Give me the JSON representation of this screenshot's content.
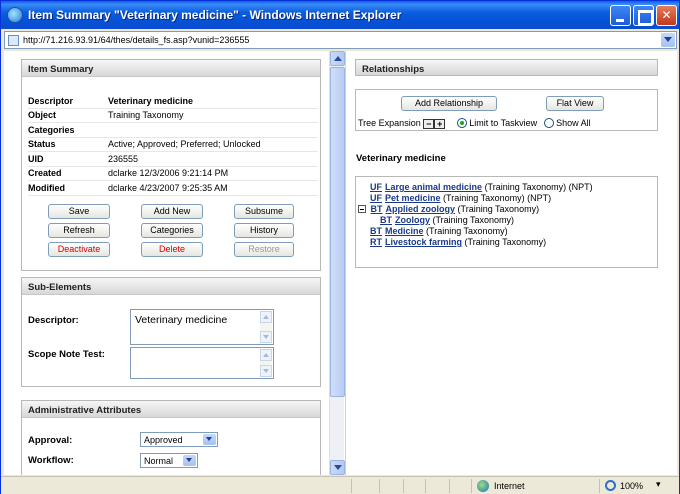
{
  "window": {
    "title": "Item Summary \"Veterinary medicine\" - Windows Internet Explorer",
    "url": "http://71.216.93.91/64/thes/details_fs.asp?vunid=236555"
  },
  "item_summary": {
    "header": "Item Summary",
    "rows": [
      {
        "key": "Descriptor",
        "value": "Veterinary medicine"
      },
      {
        "key": "Object",
        "value": "Training Taxonomy"
      },
      {
        "key": "Categories",
        "value": ""
      },
      {
        "key": "Status",
        "value": "Active; Approved; Preferred; Unlocked"
      },
      {
        "key": "UID",
        "value": "236555"
      },
      {
        "key": "Created",
        "value": "dclarke 12/3/2006 9:21:14 PM"
      },
      {
        "key": "Modified",
        "value": "dclarke 4/23/2007 9:25:35 AM"
      }
    ],
    "buttons": {
      "save": "Save",
      "add_new": "Add New",
      "subsume": "Subsume",
      "refresh": "Refresh",
      "categories": "Categories",
      "history": "History",
      "deactivate": "Deactivate",
      "delete": "Delete",
      "restore": "Restore"
    }
  },
  "sub_elements": {
    "header": "Sub-Elements",
    "descriptor_label": "Descriptor:",
    "descriptor_value": "Veterinary medicine",
    "scope_note_label": "Scope Note Test:",
    "scope_note_value": ""
  },
  "admin": {
    "header": "Administrative Attributes",
    "approval_label": "Approval:",
    "approval_value": "Approved",
    "workflow_label": "Workflow:",
    "workflow_value": "Normal"
  },
  "relationships": {
    "header": "Relationships",
    "add_button": "Add Relationship",
    "flat_view_button": "Flat View",
    "tree_expansion_label": "Tree Expansion",
    "limit_option": "Limit to Taskview",
    "show_all_option": "Show All",
    "current_term": "Veterinary medicine",
    "items": [
      {
        "type": "UF",
        "term": "Large animal medicine",
        "note": "(Training Taxonomy) (NPT)"
      },
      {
        "type": "UF",
        "term": "Pet medicine",
        "note": "(Training Taxonomy) (NPT)"
      },
      {
        "type": "BT",
        "term": "Applied zoology",
        "note": "(Training Taxonomy)"
      },
      {
        "type": "BT",
        "term": "Zoology",
        "note": "(Training Taxonomy)"
      },
      {
        "type": "BT",
        "term": "Medicine",
        "note": "(Training Taxonomy)"
      },
      {
        "type": "RT",
        "term": "Livestock farming",
        "note": "(Training Taxonomy)"
      }
    ]
  },
  "statusbar": {
    "zone": "Internet",
    "zoom": "100%"
  }
}
